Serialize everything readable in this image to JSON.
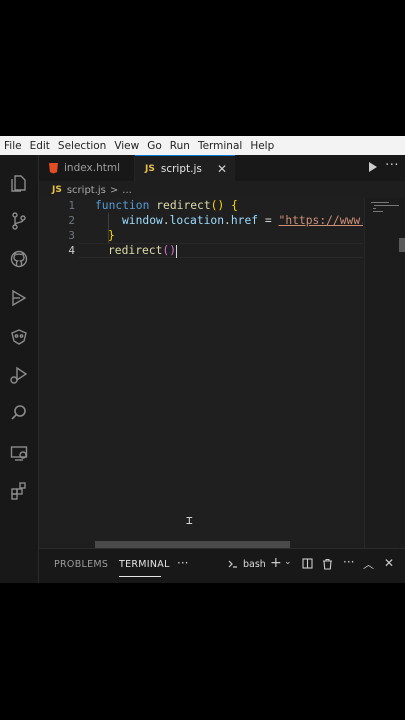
{
  "menu": [
    "File",
    "Edit",
    "Selection",
    "View",
    "Go",
    "Run",
    "Terminal",
    "Help"
  ],
  "activity_icons": [
    "files-icon",
    "source-control-icon",
    "github-icon",
    "extensions-icon",
    "testing-icon",
    "run-debug-icon",
    "search-icon",
    "remote-explorer-icon",
    "extension-blocks-icon"
  ],
  "tabs": [
    {
      "label": "index.html",
      "icon": "html5-icon",
      "active": false
    },
    {
      "label": "script.js",
      "icon": "js-icon",
      "active": true
    }
  ],
  "js_badge": "JS",
  "breadcrumb": {
    "file": "script.js",
    "separator": ">",
    "more": "..."
  },
  "editor": {
    "line_numbers": [
      "1",
      "2",
      "3",
      "4"
    ],
    "line1": {
      "keyword": "function",
      "name": "redirect",
      "paren": "()",
      "brace": "{"
    },
    "line2": {
      "object": "window",
      "prop1": "location",
      "prop2": "href",
      "op": "=",
      "string": "\"https://www."
    },
    "line3": {
      "brace": "}"
    },
    "line4": {
      "name": "redirect",
      "paren_open": "(",
      "paren_close": ")"
    }
  },
  "panel": {
    "tabs": [
      "PROBLEMS",
      "TERMINAL"
    ],
    "active_tab": "TERMINAL",
    "more": "···",
    "terminal_name": "bash"
  },
  "colors": {
    "accent": "#0078d4",
    "keyword": "#569cd6",
    "function": "#dcdcaa",
    "variable": "#9cdcfe",
    "string": "#ce9178",
    "bracket": "#ffd700"
  }
}
